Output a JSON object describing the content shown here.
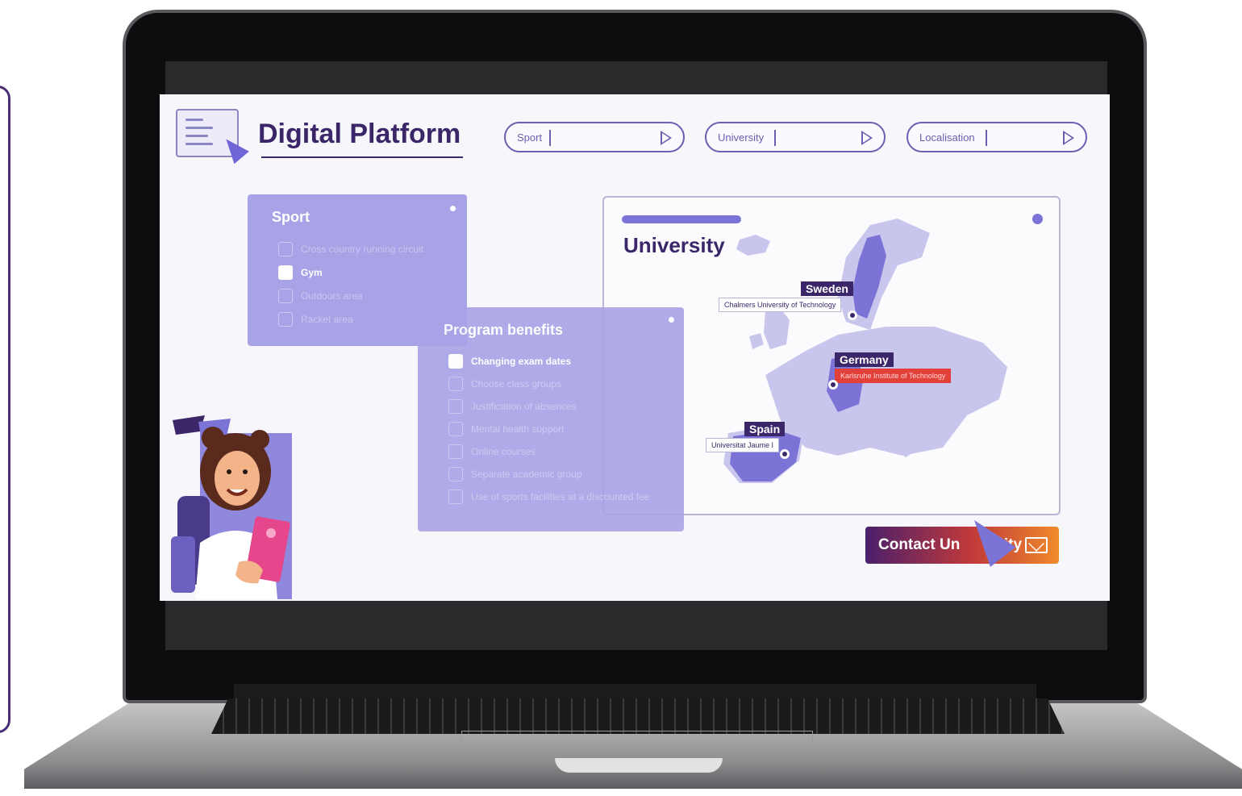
{
  "app": {
    "title": "Digital Platform"
  },
  "search": {
    "sport_label": "Sport",
    "university_label": "University",
    "localisation_label": "Localisation"
  },
  "sport_panel": {
    "title": "Sport",
    "options": [
      {
        "label": "Cross country running circuit",
        "checked": false
      },
      {
        "label": "Gym",
        "checked": true
      },
      {
        "label": "Outdoors area",
        "checked": false
      },
      {
        "label": "Racket area",
        "checked": false
      }
    ]
  },
  "benefits_panel": {
    "title": "Program benefits",
    "options": [
      {
        "label": "Changing exam dates",
        "checked": true
      },
      {
        "label": "Choose class groups",
        "checked": false
      },
      {
        "label": "Justification of absences",
        "checked": false
      },
      {
        "label": "Mental health support",
        "checked": false
      },
      {
        "label": "Online courses",
        "checked": false
      },
      {
        "label": "Separate academic group",
        "checked": false
      },
      {
        "label": "Use of sports facilities at a discounted fee",
        "checked": false
      }
    ]
  },
  "university_card": {
    "title": "University",
    "countries": [
      {
        "country": "Sweden",
        "university": "Chalmers University of Technology"
      },
      {
        "country": "Germany",
        "university": "Karlsruhe Institute of Technology"
      },
      {
        "country": "Spain",
        "university": "Universitat Jaume I"
      }
    ]
  },
  "contact_button": {
    "label": "Contact University",
    "visible_label": "Contact Un",
    "visible_label_end": "sity"
  },
  "colors": {
    "brand_dark": "#3a2669",
    "accent_purple": "#7b74d6",
    "panel_purple": "#a8a3e6",
    "highlight_red": "#e3403a",
    "frame_purple": "#4a2d73"
  },
  "icons": [
    "search-arrow-icon",
    "mail-icon",
    "cursor-icon",
    "map-pin-icon",
    "checkbox-icon",
    "platform-logo-icon"
  ]
}
